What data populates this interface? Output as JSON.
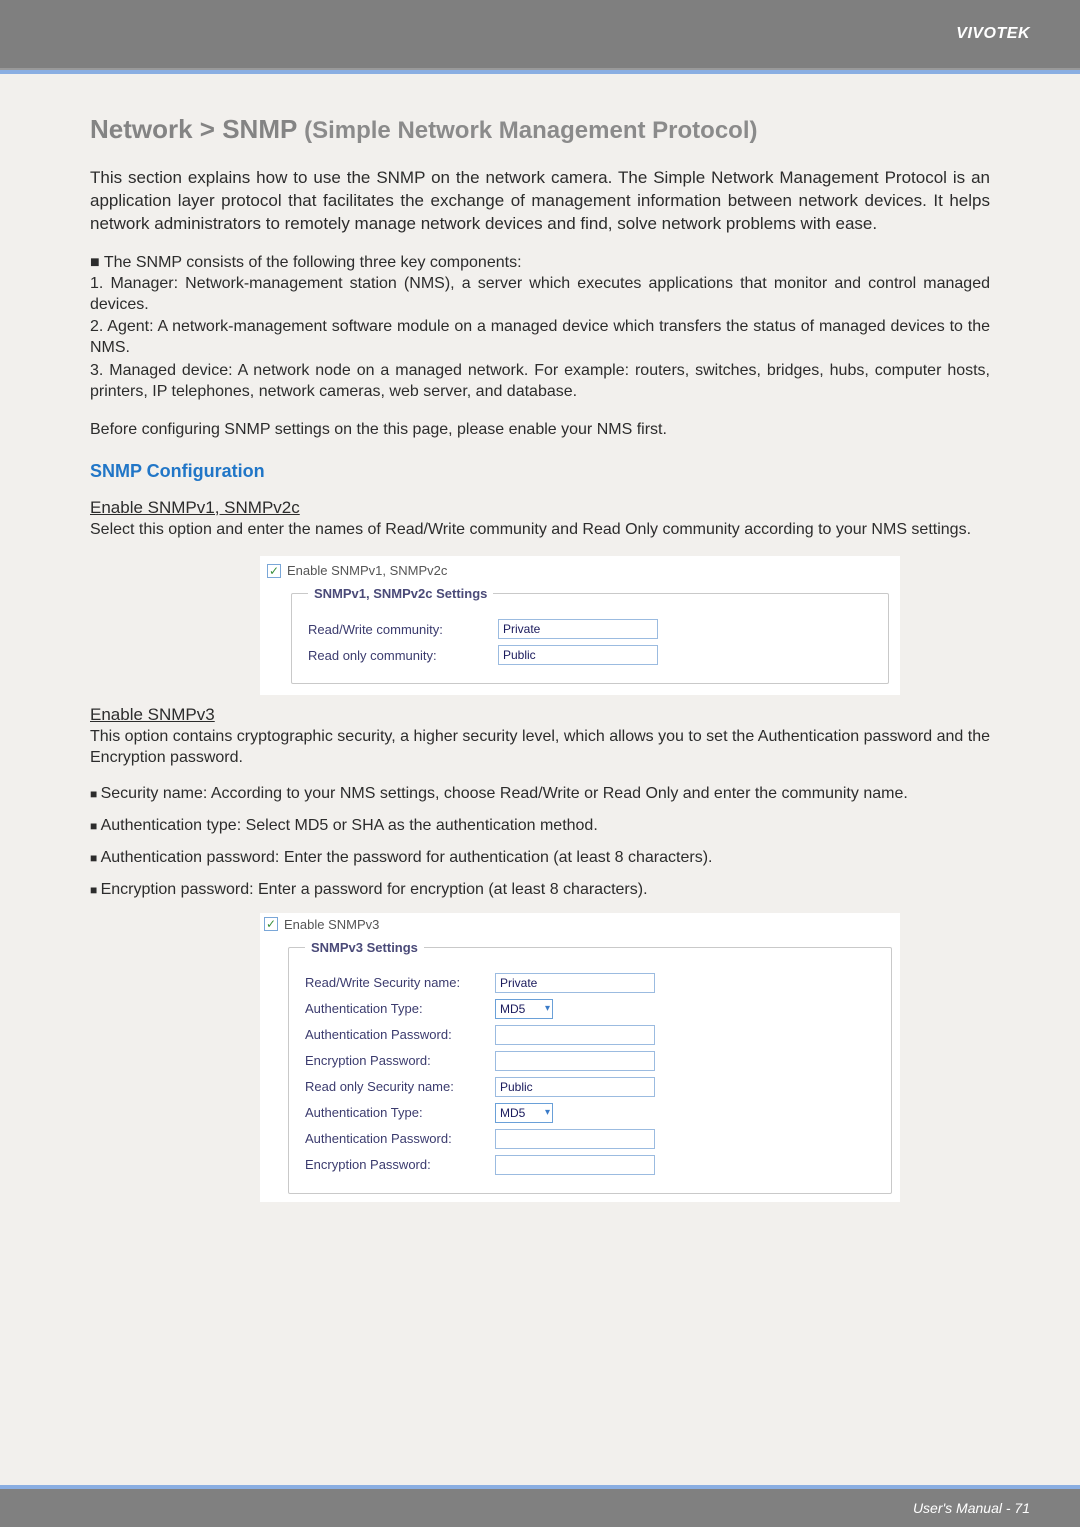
{
  "header": {
    "brand": "VIVOTEK"
  },
  "title": {
    "main": "Network > SNMP",
    "sub": "(Simple Network Management Protocol)"
  },
  "intro": "This section explains how to use the SNMP on the network camera. The Simple Network Management Protocol is an application layer protocol that facilitates the exchange of management information between network devices. It helps network administrators to remotely manage network devices and find, solve network problems with ease.",
  "components_lead": "■ The SNMP consists of the following three key components:",
  "components": [
    "1. Manager: Network-management station (NMS), a server which executes applications that monitor and control managed devices.",
    "2. Agent: A network-management software module on a managed device which transfers the status of managed devices to the NMS.",
    "3. Managed device: A network node on a managed network. For example: routers, switches, bridges, hubs, computer hosts, printers, IP telephones, network cameras, web server, and database."
  ],
  "before_config": "Before configuring SNMP settings on the this page, please enable your NMS first.",
  "section_blue": "SNMP Configuration",
  "enable_v12_heading": "Enable SNMPv1, SNMPv2c",
  "enable_v12_desc": "Select this option and enter the names of Read/Write community and Read Only community according to your NMS settings.",
  "panel_v12": {
    "checkbox_label": "Enable SNMPv1, SNMPv2c",
    "legend": "SNMPv1, SNMPv2c Settings",
    "rw_label": "Read/Write community:",
    "rw_value": "Private",
    "ro_label": "Read only community:",
    "ro_value": "Public"
  },
  "enable_v3_heading": "Enable SNMPv3",
  "enable_v3_desc": "This option contains cryptographic security, a higher security level, which allows you to set the Authentication password and the Encryption password.",
  "v3_bullets": [
    "Security name: According to your NMS settings, choose Read/Write or Read Only and enter the community name.",
    "Authentication type: Select MD5 or SHA as the authentication method.",
    "Authentication password: Enter the password for authentication (at least 8 characters).",
    "Encryption password: Enter a password for encryption (at least 8 characters)."
  ],
  "panel_v3": {
    "checkbox_label": "Enable SNMPv3",
    "legend": "SNMPv3 Settings",
    "rw_sec_label": "Read/Write Security name:",
    "rw_sec_value": "Private",
    "auth_type_label": "Authentication Type:",
    "auth_type_value": "MD5",
    "auth_pw_label": "Authentication Password:",
    "enc_pw_label": "Encryption Password:",
    "ro_sec_label": "Read only Security name:",
    "ro_sec_value": "Public",
    "auth_type_label2": "Authentication Type:",
    "auth_type_value2": "MD5",
    "auth_pw_label2": "Authentication Password:",
    "enc_pw_label2": "Encryption Password:"
  },
  "footer": {
    "text": "User's Manual - 71"
  }
}
